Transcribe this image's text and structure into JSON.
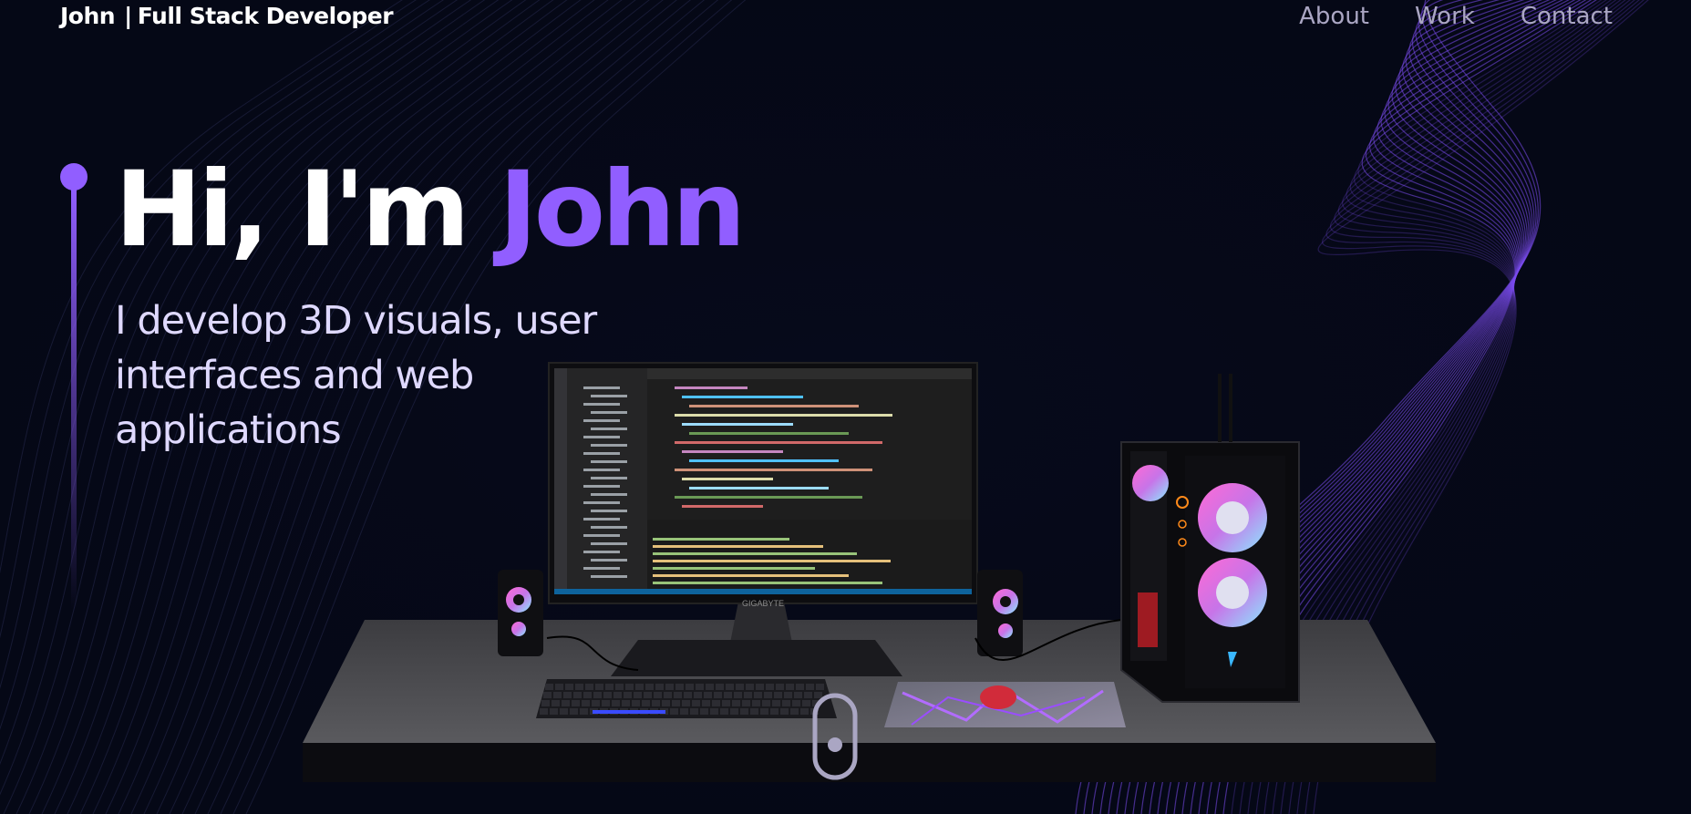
{
  "navbar": {
    "brand_name": "John",
    "brand_separator": "|",
    "brand_role": "Full Stack Developer",
    "links": [
      {
        "label": "About"
      },
      {
        "label": "Work"
      },
      {
        "label": "Contact"
      }
    ]
  },
  "hero": {
    "greeting": "Hi, I'm ",
    "name": "John",
    "subtitle": "I develop 3D visuals, user interfaces and web applications"
  },
  "scene": {
    "monitor_brand": "GIGABYTE"
  },
  "colors": {
    "background": "#050816",
    "accent": "#915eff",
    "nav_text": "#aaa6c3",
    "subtitle_text": "#dfd9ff"
  },
  "icons": {
    "scroll": "mouse-scroll-icon"
  }
}
